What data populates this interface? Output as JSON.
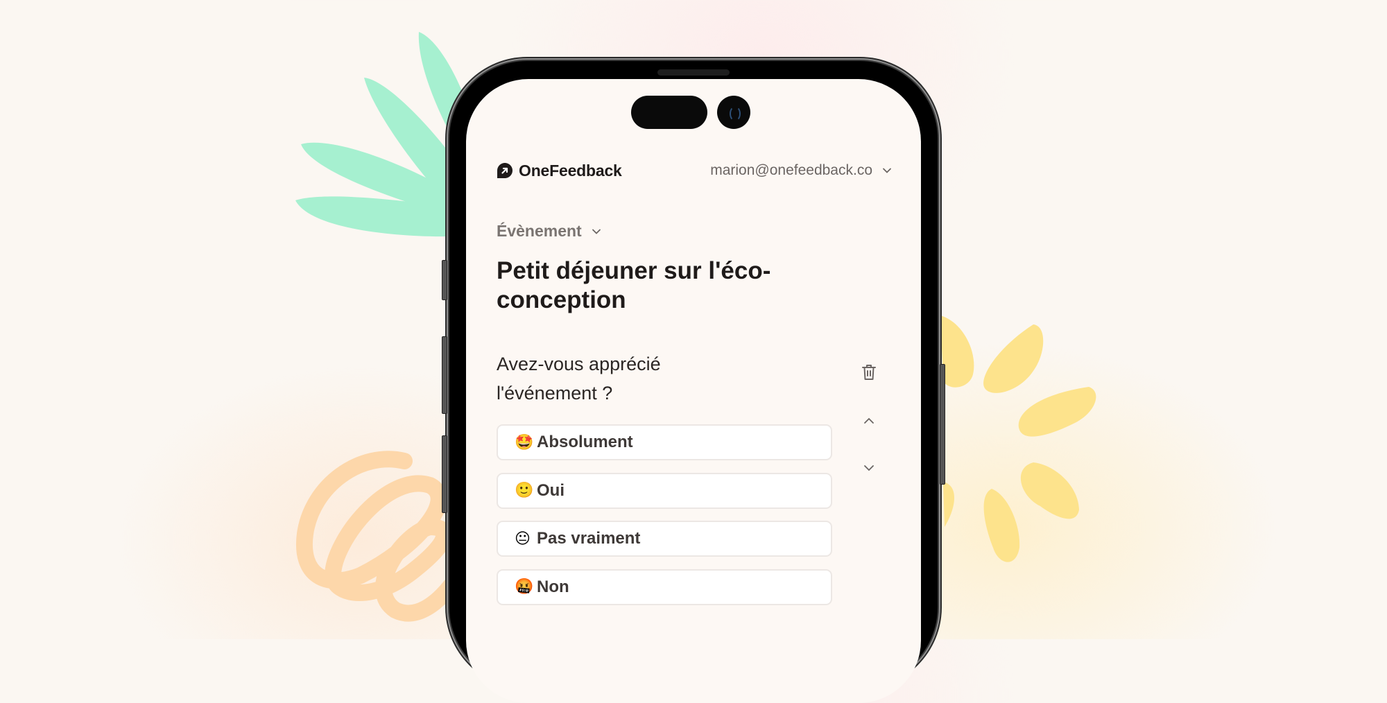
{
  "app": {
    "brand_name": "OneFeedback",
    "account_email": "marion@onefeedback.co"
  },
  "form": {
    "category_label": "Évènement",
    "title": "Petit déjeuner sur l'éco-conception",
    "question": {
      "text": "Avez-vous apprécié l'événement ?",
      "options": [
        {
          "emoji": "🤩",
          "label": "Absolument"
        },
        {
          "emoji": "🙂",
          "label": "Oui"
        },
        {
          "emoji": "😐",
          "label": "Pas vraiment"
        },
        {
          "emoji": "🤬",
          "label": "Non"
        }
      ]
    }
  },
  "icons": {
    "brand": "arrow-up-right-bubble-icon",
    "account_menu": "chevron-down-icon",
    "category_menu": "chevron-down-icon",
    "delete": "trash-icon",
    "move_up": "chevron-up-icon",
    "move_down": "chevron-down-icon"
  },
  "colors": {
    "background": "#fbf7f2",
    "screen": "#fdf8f4",
    "text_primary": "#1f1b1a",
    "text_muted": "#7a7471",
    "leaf_green": "#a6f0d0",
    "sun_yellow": "#fde38c",
    "scribble_orange": "#fdd7aa"
  }
}
